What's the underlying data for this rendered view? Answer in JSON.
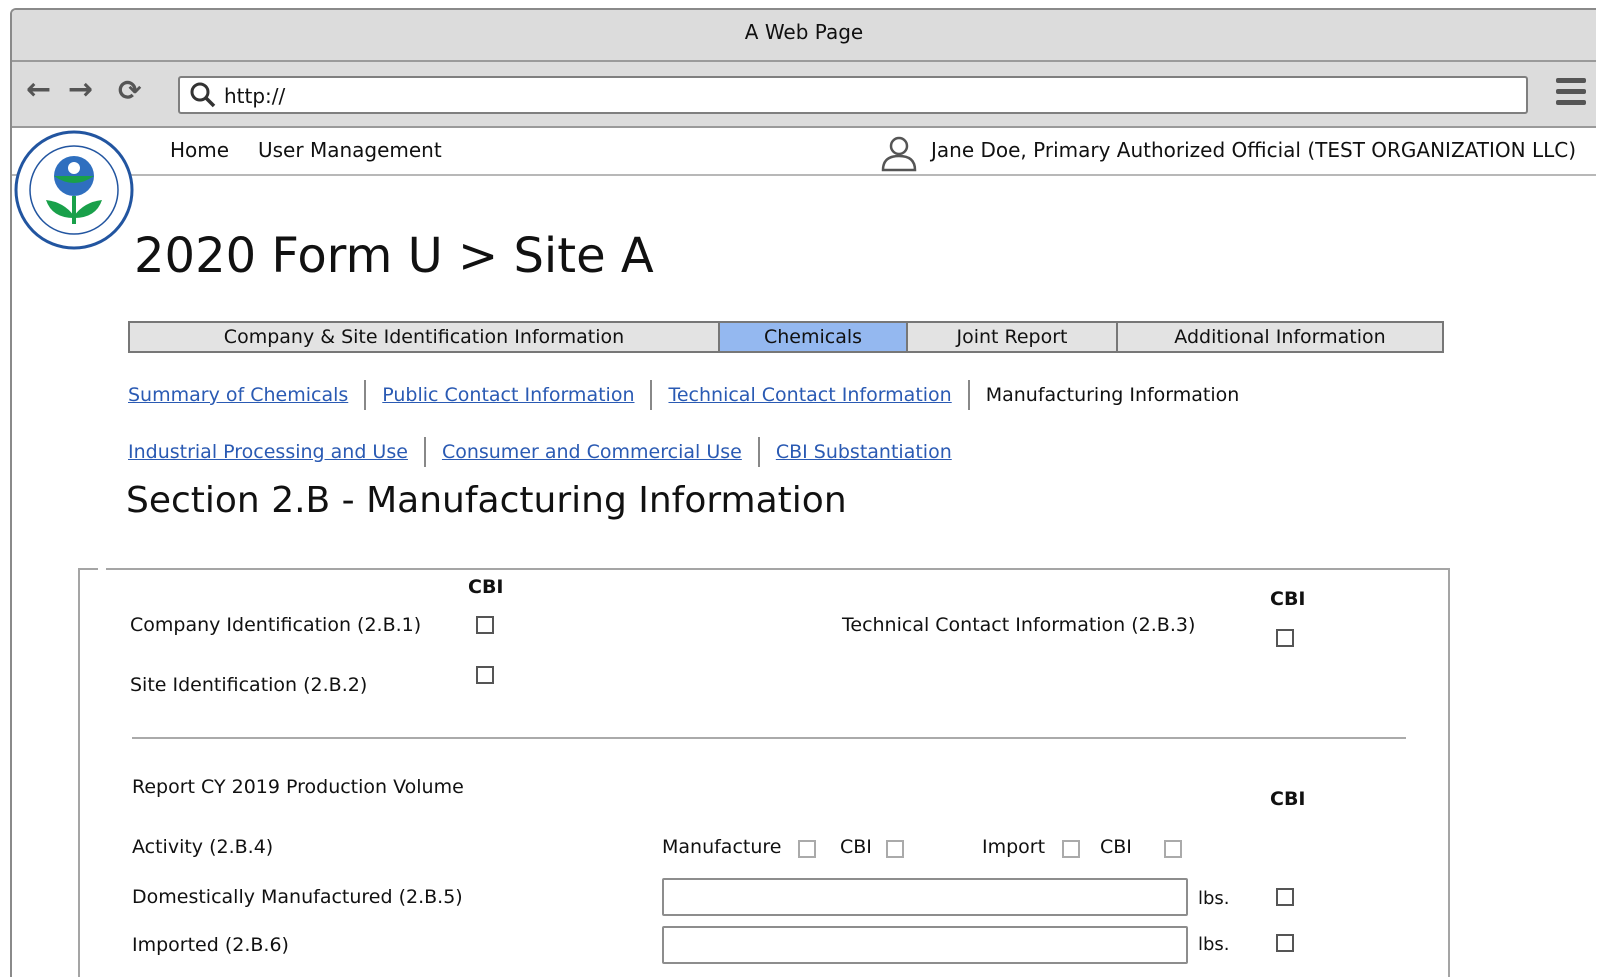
{
  "window": {
    "title": "A Web Page"
  },
  "browser": {
    "url": "http://"
  },
  "topnav": {
    "home": "Home",
    "user_management": "User Management",
    "user": "Jane Doe, Primary Authorized Official (TEST ORGANIZATION LLC)"
  },
  "page": {
    "title": "2020 Form U > Site A"
  },
  "tabs": [
    {
      "label": "Company & Site Identification Information",
      "active": false
    },
    {
      "label": "Chemicals",
      "active": true
    },
    {
      "label": "Joint Report",
      "active": false
    },
    {
      "label": "Additional Information",
      "active": false
    }
  ],
  "subnav": {
    "row1": [
      "Summary of Chemicals",
      "Public Contact Information",
      "Technical Contact Information",
      "Manufacturing Information"
    ],
    "row2": [
      "Industrial Processing and Use",
      "Consumer and Commercial Use",
      "CBI Substantiation"
    ]
  },
  "section": {
    "title": "Section 2.B - Manufacturing Information"
  },
  "form": {
    "cbi": "CBI",
    "company_id": "Company Identification (2.B.1)",
    "site_id": "Site Identification (2.B.2)",
    "tech_contact": "Technical Contact Information (2.B.3)",
    "report_volume": "Report CY 2019 Production Volume",
    "activity": "Activity (2.B.4)",
    "manufacture": "Manufacture",
    "import": "Import",
    "domestic": "Domestically Manufactured (2.B.5)",
    "imported": "Imported (2.B.6)",
    "unit": "lbs."
  },
  "colors": {
    "active_tab": "#94b8f0",
    "link": "#2a5ab3"
  }
}
